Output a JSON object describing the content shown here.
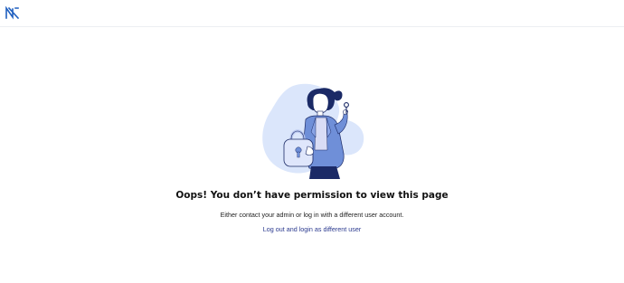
{
  "header": {
    "logo_icon": "brand-logo-icon"
  },
  "error": {
    "title": "Oops! You don’t have permission to view this page",
    "message": "Either contact your admin or log in with a different user account.",
    "link_label": "Log out and login as different user"
  },
  "illustration": {
    "icon": "locked-padlock-person-illustration"
  },
  "colors": {
    "brand_blue": "#1f5fbf",
    "link": "#2b3a8f",
    "blob": "#dbe6fb",
    "jacket": "#6f8fd8",
    "navy": "#1b2a66"
  }
}
